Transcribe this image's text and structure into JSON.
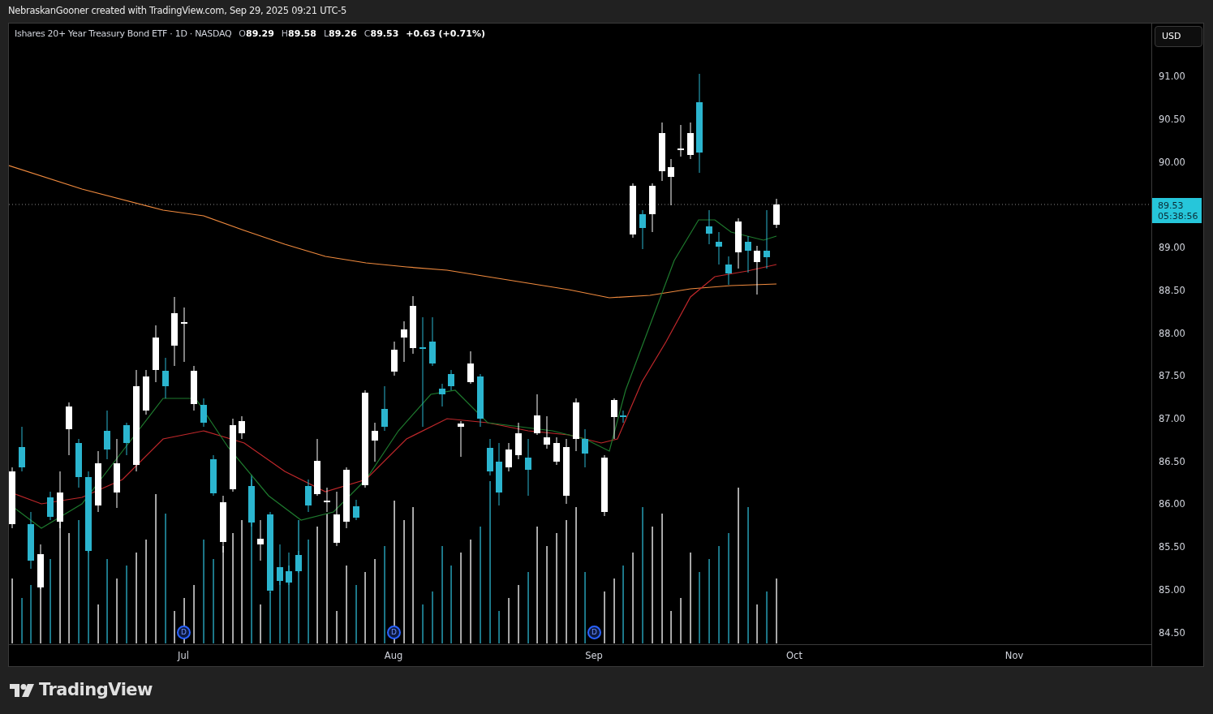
{
  "caption": "NebraskanGooner created with TradingView.com, Sep 29, 2025 09:21 UTC-5",
  "legend": {
    "title": "Ishares 20+ Year Treasury Bond ETF · 1D · NASDAQ",
    "values": [
      {
        "label": "O",
        "value": "89.29"
      },
      {
        "label": "H",
        "value": "89.58"
      },
      {
        "label": "L",
        "value": "89.26"
      },
      {
        "label": "C",
        "value": "89.53"
      }
    ],
    "change": "+0.63 (+0.71%)"
  },
  "currency_button": "USD",
  "price_axis": [
    "91.00",
    "90.50",
    "90.00",
    "89.00",
    "88.50",
    "88.00",
    "87.50",
    "87.00",
    "86.50",
    "86.00",
    "85.50",
    "85.00",
    "84.50"
  ],
  "last_price": {
    "price": "89.53",
    "countdown": "05:38:56"
  },
  "dividend_markers": [
    "D",
    "D",
    "D"
  ],
  "time_axis": [
    "Jul",
    "Aug",
    "Sep",
    "Oct",
    "Nov"
  ],
  "footer": {
    "brand": "TradingView"
  }
}
